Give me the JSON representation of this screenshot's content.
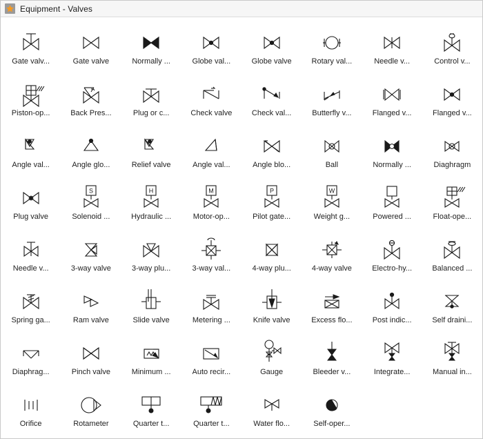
{
  "window": {
    "title": "Equipment - Valves",
    "icon": "star-icon",
    "icon_color": "#f59a23",
    "background": "#ffffff",
    "titlebar_background": "#f6f6f6",
    "stroke_color": "#1a1a1a",
    "text_color": "#222222"
  },
  "grid": {
    "columns": 8,
    "rows": 8,
    "total_items": 64
  },
  "items": [
    {
      "label": "Gate valv...",
      "shape": "gate-valve-handwheel"
    },
    {
      "label": "Gate valve",
      "shape": "gate-valve"
    },
    {
      "label": "Normally ...",
      "shape": "normally-closed-filled-bowtie"
    },
    {
      "label": "Globe val...",
      "shape": "globe-valve-dot"
    },
    {
      "label": "Globe valve",
      "shape": "globe-valve-dot2"
    },
    {
      "label": "Rotary val...",
      "shape": "rotary-valve-circle"
    },
    {
      "label": "Needle v...",
      "shape": "needle-valve-bowtie"
    },
    {
      "label": "Control v...",
      "shape": "control-valve-actuator"
    },
    {
      "label": "Piston-op...",
      "shape": "piston-operated-valve"
    },
    {
      "label": "Back Pres...",
      "shape": "back-pressure-valve"
    },
    {
      "label": "Plug or c...",
      "shape": "plug-or-cock-valve"
    },
    {
      "label": "Check valve",
      "shape": "check-valve-zigzag"
    },
    {
      "label": "Check val...",
      "shape": "check-valve-arrow"
    },
    {
      "label": "Butterfly v...",
      "shape": "butterfly-valve"
    },
    {
      "label": "Flanged v...",
      "shape": "flanged-valve-bars"
    },
    {
      "label": "Flanged v...",
      "shape": "flanged-valve-dot"
    },
    {
      "label": "Angle val...",
      "shape": "angle-valve-dot"
    },
    {
      "label": "Angle glo...",
      "shape": "angle-globe-valve"
    },
    {
      "label": "Relief valve",
      "shape": "relief-valve"
    },
    {
      "label": "Angle val...",
      "shape": "angle-valve-open"
    },
    {
      "label": "Angle blo...",
      "shape": "angle-blowdown-valve"
    },
    {
      "label": "Ball",
      "shape": "ball-valve"
    },
    {
      "label": "Normally ...",
      "shape": "normally-closed-ball"
    },
    {
      "label": "Diaghragm",
      "shape": "diaphragm-valve"
    },
    {
      "label": "Plug valve",
      "shape": "plug-valve"
    },
    {
      "label": "Solenoid ...",
      "shape": "solenoid-valve-S"
    },
    {
      "label": "Hydraulic ...",
      "shape": "hydraulic-valve-H"
    },
    {
      "label": "Motor-op...",
      "shape": "motor-operated-valve-M"
    },
    {
      "label": "Pilot gate...",
      "shape": "pilot-gate-valve-P"
    },
    {
      "label": "Weight g...",
      "shape": "weight-gate-valve-W"
    },
    {
      "label": "Powered ...",
      "shape": "powered-valve-box"
    },
    {
      "label": "Float-ope...",
      "shape": "float-operated-valve"
    },
    {
      "label": "Needle v...",
      "shape": "needle-valve-stem"
    },
    {
      "label": "3-way valve",
      "shape": "three-way-valve"
    },
    {
      "label": "3-way plu...",
      "shape": "three-way-plug-valve"
    },
    {
      "label": "3-way val...",
      "shape": "three-way-valve-actuator"
    },
    {
      "label": "4-way plu...",
      "shape": "four-way-plug-valve"
    },
    {
      "label": "4-way valve",
      "shape": "four-way-valve"
    },
    {
      "label": "Electro-hy...",
      "shape": "electro-hydraulic-valve"
    },
    {
      "label": "Balanced ...",
      "shape": "balanced-valve"
    },
    {
      "label": "Spring ga...",
      "shape": "spring-gate-valve"
    },
    {
      "label": "Ram valve",
      "shape": "ram-valve"
    },
    {
      "label": "Slide valve",
      "shape": "slide-valve"
    },
    {
      "label": "Metering ...",
      "shape": "metering-valve"
    },
    {
      "label": "Knife valve",
      "shape": "knife-valve"
    },
    {
      "label": "Excess flo...",
      "shape": "excess-flow-valve"
    },
    {
      "label": "Post indic...",
      "shape": "post-indicator-valve"
    },
    {
      "label": "Self draini...",
      "shape": "self-draining-valve"
    },
    {
      "label": "Diaphrag...",
      "shape": "diaphragm-operated-valve"
    },
    {
      "label": "Pinch valve",
      "shape": "pinch-valve"
    },
    {
      "label": "Minimum ...",
      "shape": "minimum-flow-valve"
    },
    {
      "label": "Auto recir...",
      "shape": "auto-recirculation-valve"
    },
    {
      "label": "Gauge",
      "shape": "gauge"
    },
    {
      "label": "Bleeder v...",
      "shape": "bleeder-valve"
    },
    {
      "label": "Integrate...",
      "shape": "integrated-valve"
    },
    {
      "label": "Manual in...",
      "shape": "manual-integrated-valve"
    },
    {
      "label": "Orifice",
      "shape": "orifice"
    },
    {
      "label": "Rotameter",
      "shape": "rotameter"
    },
    {
      "label": "Quarter t...",
      "shape": "quarter-turn-valve"
    },
    {
      "label": "Quarter t...",
      "shape": "quarter-turn-spring-valve"
    },
    {
      "label": "Water flo...",
      "shape": "water-flow-valve"
    },
    {
      "label": "Self-oper...",
      "shape": "self-operated-valve"
    }
  ]
}
